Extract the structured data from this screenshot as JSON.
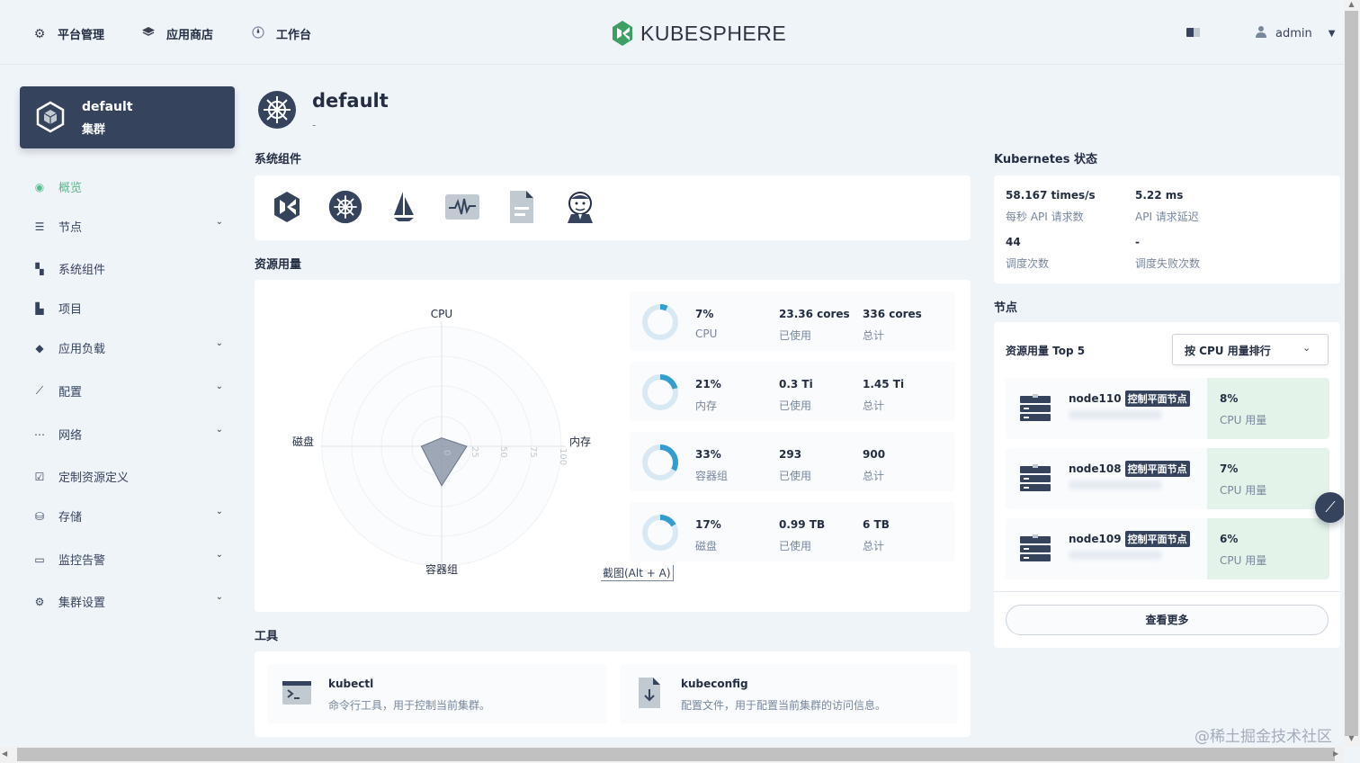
{
  "topnav": {
    "platform": "平台管理",
    "appstore": "应用商店",
    "workbench": "工作台",
    "logo_text": "KUBESPHERE",
    "user": "admin"
  },
  "cluster": {
    "name": "default",
    "type": "集群"
  },
  "sidebar": {
    "items": [
      {
        "label": "概览"
      },
      {
        "label": "节点"
      },
      {
        "label": "系统组件"
      },
      {
        "label": "项目"
      },
      {
        "label": "应用负载"
      },
      {
        "label": "配置"
      },
      {
        "label": "网络"
      },
      {
        "label": "定制资源定义"
      },
      {
        "label": "存储"
      },
      {
        "label": "监控告警"
      },
      {
        "label": "集群设置"
      }
    ]
  },
  "header": {
    "title": "default",
    "subtitle": "-"
  },
  "sections": {
    "components": "系统组件",
    "usage": "资源用量",
    "tools": "工具",
    "k8s_status": "Kubernetes 状态",
    "nodes": "节点"
  },
  "radar": {
    "axes": [
      "CPU",
      "内存",
      "容器组",
      "磁盘"
    ],
    "ticks": [
      "0",
      "25",
      "50",
      "75",
      "100"
    ],
    "values": [
      7,
      21,
      33,
      17
    ]
  },
  "resources": [
    {
      "percent": "7%",
      "name": "CPU",
      "used": "23.36 cores",
      "used_label": "已使用",
      "total": "336 cores",
      "total_label": "总计",
      "ratio": 0.07
    },
    {
      "percent": "21%",
      "name": "内存",
      "used": "0.3 Ti",
      "used_label": "已使用",
      "total": "1.45 Ti",
      "total_label": "总计",
      "ratio": 0.21
    },
    {
      "percent": "33%",
      "name": "容器组",
      "used": "293",
      "used_label": "已使用",
      "total": "900",
      "total_label": "总计",
      "ratio": 0.33
    },
    {
      "percent": "17%",
      "name": "磁盘",
      "used": "0.99 TB",
      "used_label": "已使用",
      "total": "6 TB",
      "total_label": "总计",
      "ratio": 0.17
    }
  ],
  "screenshot_hint": "截图(Alt + A)",
  "k8s": {
    "api_rate": "58.167 times/s",
    "api_rate_label": "每秒 API 请求数",
    "api_latency": "5.22 ms",
    "api_latency_label": "API 请求延迟",
    "schedule": "44",
    "schedule_label": "调度次数",
    "schedule_fail": "-",
    "schedule_fail_label": "调度失败次数"
  },
  "nodes_panel": {
    "title": "资源用量 Top 5",
    "sort": "按 CPU 用量排行",
    "view_more": "查看更多",
    "rows": [
      {
        "name": "node110",
        "tag": "控制平面节点",
        "percent": "8%",
        "label": "CPU 用量"
      },
      {
        "name": "node108",
        "tag": "控制平面节点",
        "percent": "7%",
        "label": "CPU 用量"
      },
      {
        "name": "node109",
        "tag": "控制平面节点",
        "percent": "6%",
        "label": "CPU 用量"
      }
    ]
  },
  "tools": [
    {
      "name": "kubectl",
      "desc": "命令行工具，用于控制当前集群。"
    },
    {
      "name": "kubeconfig",
      "desc": "配置文件，用于配置当前集群的访问信息。"
    }
  ],
  "watermark": "@稀土掘金技术社区",
  "colors": {
    "accent": "#55bc8a",
    "dark": "#36435c",
    "ring": "#329dce",
    "ring_bg": "#d8e9f4"
  }
}
